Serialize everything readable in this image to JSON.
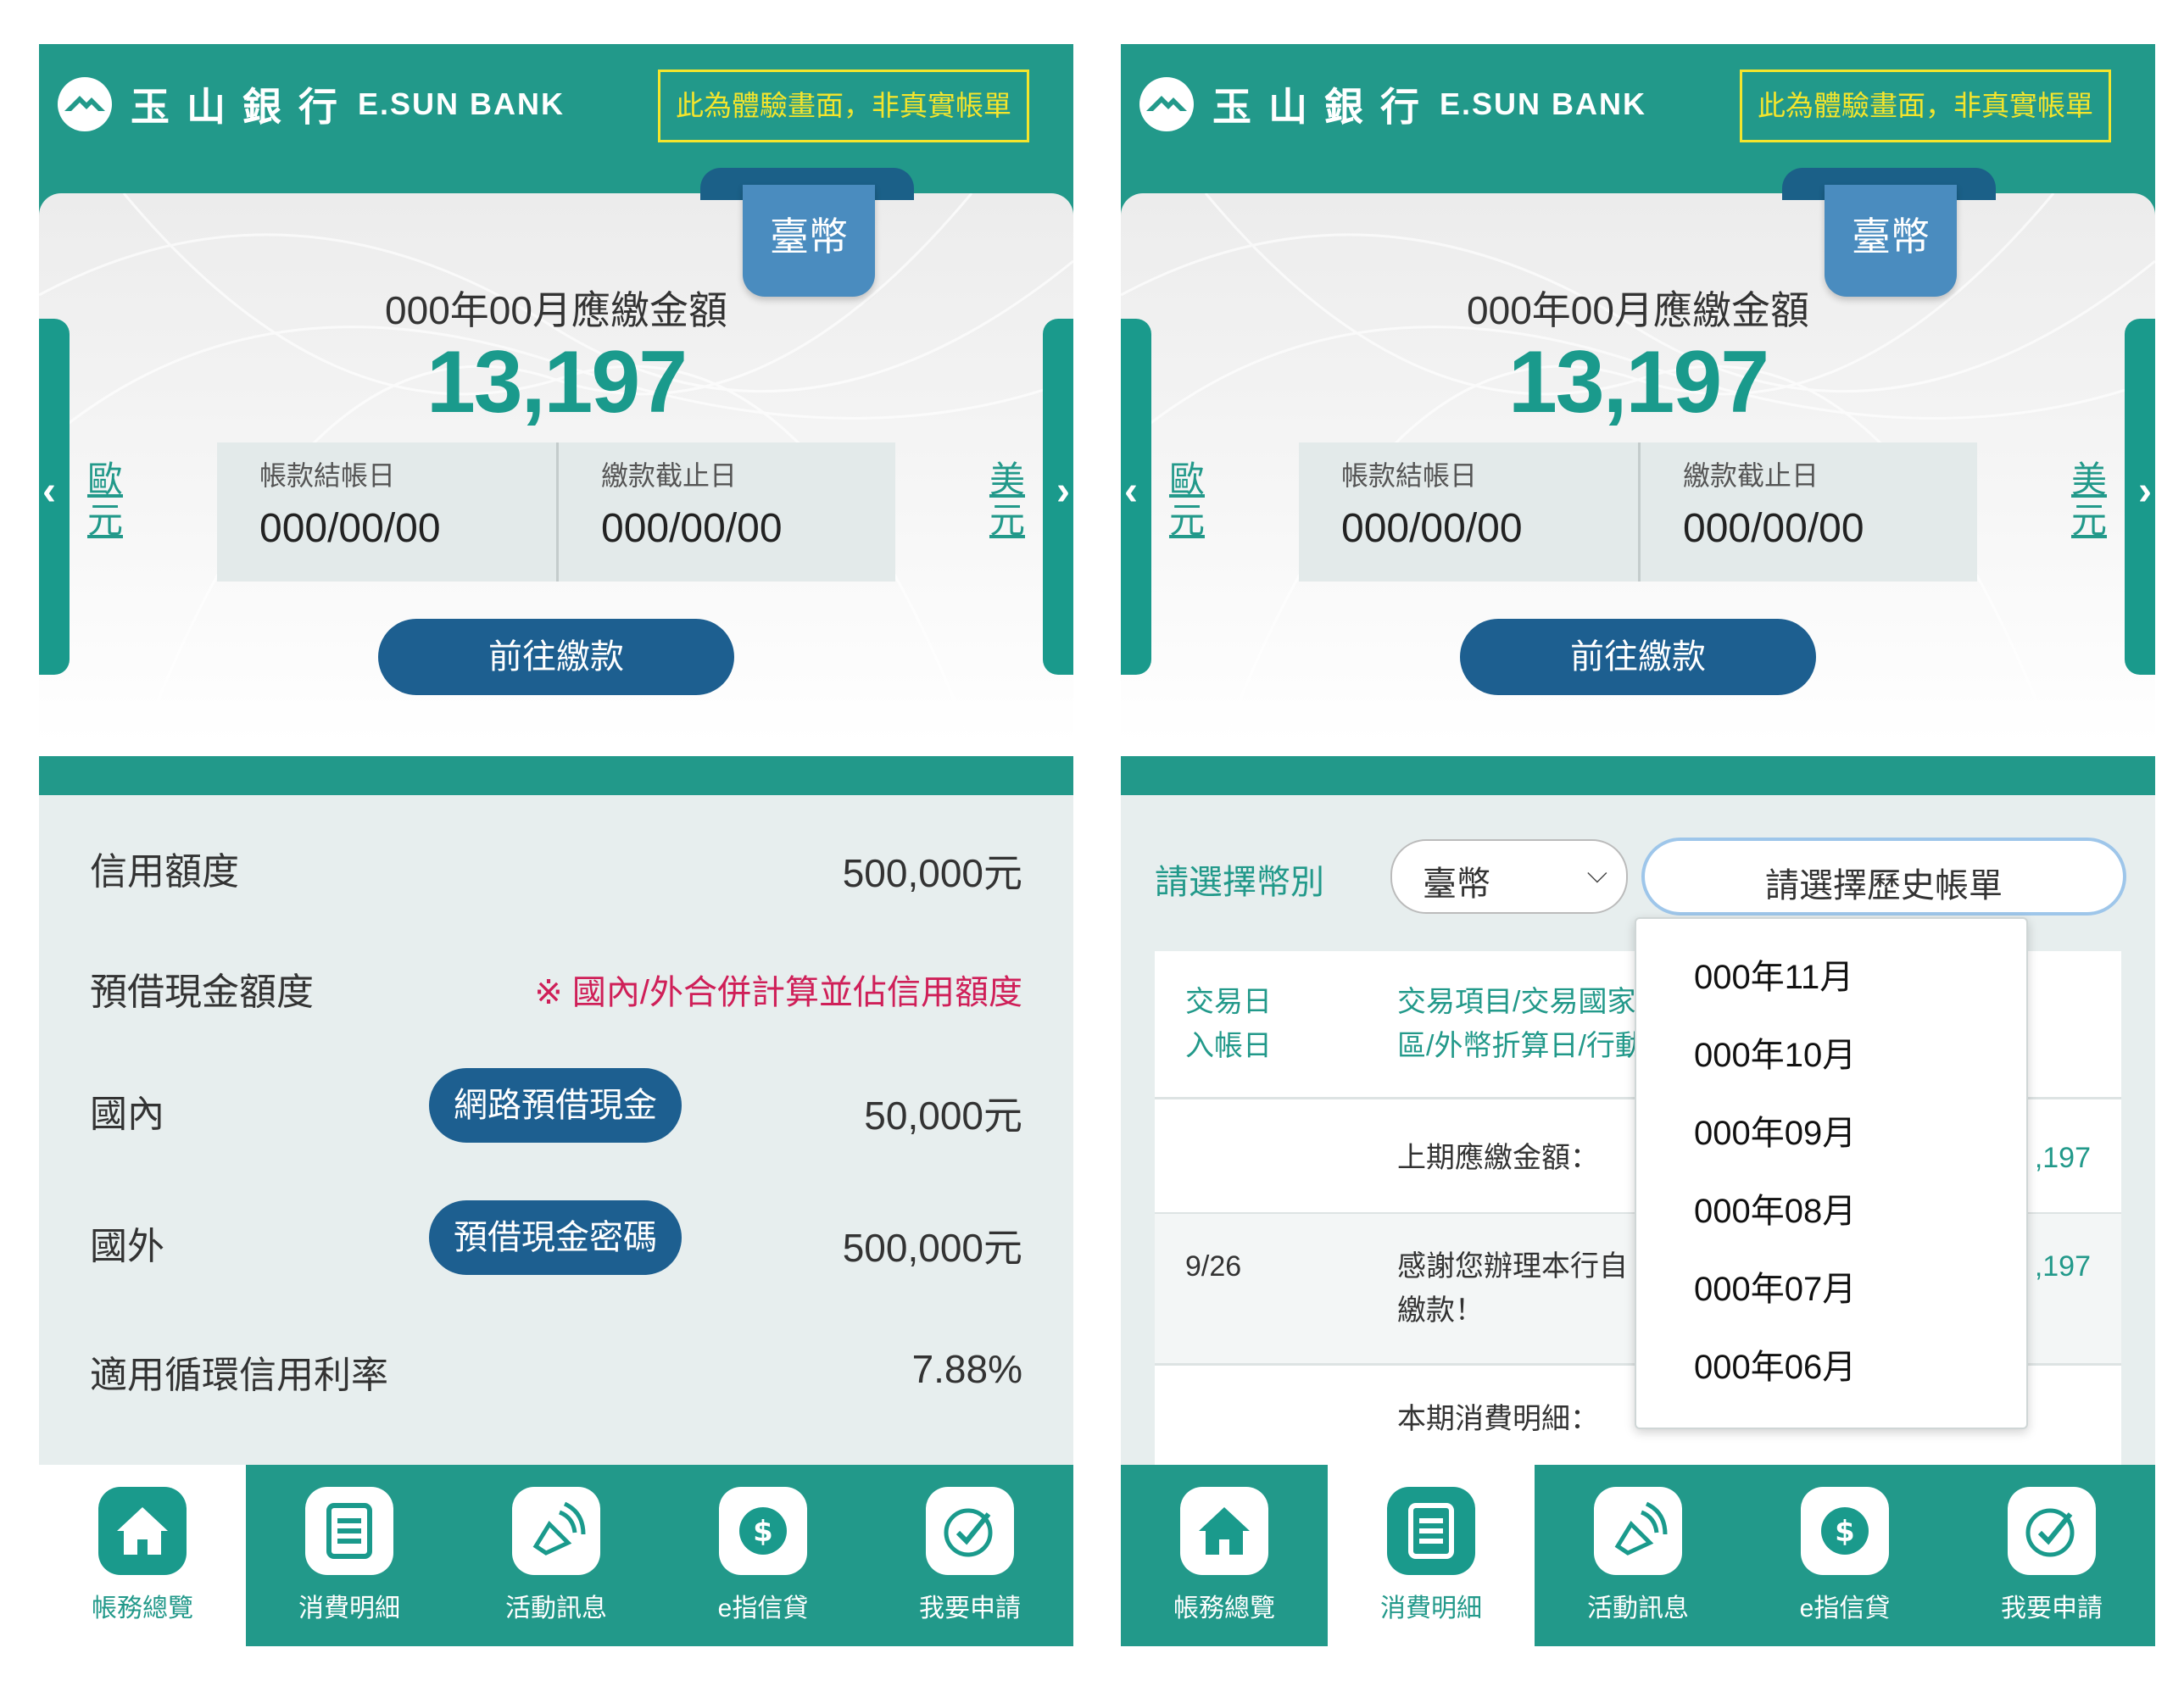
{
  "brand": {
    "name_cn": "玉山銀行",
    "name_en": "E.SUN BANK",
    "demo_notice": "此為體驗畫面，非真實帳單"
  },
  "colors": {
    "primary": "#22998a",
    "accent": "#1a9a8c",
    "button": "#1d5f90",
    "badge": "#f4e52c",
    "warning": "#cf1f58",
    "ribbon": "#4a8cbf"
  },
  "summary": {
    "currency_tab": "臺幣",
    "due_title": "000年00月應繳金額",
    "due_amount": "13,197",
    "statement_date_label": "帳款結帳日",
    "statement_date": "000/00/00",
    "due_date_label": "繳款截止日",
    "due_date": "000/00/00",
    "prev_currency": "歐元",
    "next_currency": "美元",
    "prev_arrow": "‹",
    "next_arrow": "›",
    "pay_button": "前往繳款"
  },
  "credit": {
    "limit_label": "信用額度",
    "limit_value": "500,000元",
    "cash_label": "預借現金額度",
    "cash_note": "※ 國內/外合併計算並佔信用額度",
    "domestic_label": "國內",
    "domestic_button": "網路預借現金",
    "domestic_value": "50,000元",
    "foreign_label": "國外",
    "foreign_button": "預借現金密碼",
    "foreign_value": "500,000元",
    "rate_label": "適用循環信用利率",
    "rate_value": "7.88%"
  },
  "statement": {
    "currency_label": "請選擇幣別",
    "currency_value": "臺幣",
    "history_placeholder": "請選擇歷史帳單",
    "headers": {
      "date1": "交易日",
      "date2": "入帳日",
      "desc1": "交易項目/交易國家",
      "desc2": "區/外幣折算日/行動"
    },
    "rows": [
      {
        "date": "",
        "desc1": "上期應繳金額：",
        "desc2": "",
        "amount": ",197"
      },
      {
        "date": "9/26",
        "desc1": "感謝您辦理本行自",
        "desc2": "繳款！",
        "amount": ",197"
      },
      {
        "date": "",
        "desc1": "本期消費明細：",
        "desc2": "",
        "amount": ""
      }
    ],
    "history_options": [
      "000年11月",
      "000年10月",
      "000年09月",
      "000年08月",
      "000年07月",
      "000年06月"
    ]
  },
  "nav": {
    "items": [
      {
        "label": "帳務總覽",
        "icon": "home-icon"
      },
      {
        "label": "消費明細",
        "icon": "document-icon"
      },
      {
        "label": "活動訊息",
        "icon": "megaphone-icon"
      },
      {
        "label": "e指信貸",
        "icon": "dollar-icon"
      },
      {
        "label": "我要申請",
        "icon": "check-icon"
      }
    ]
  }
}
